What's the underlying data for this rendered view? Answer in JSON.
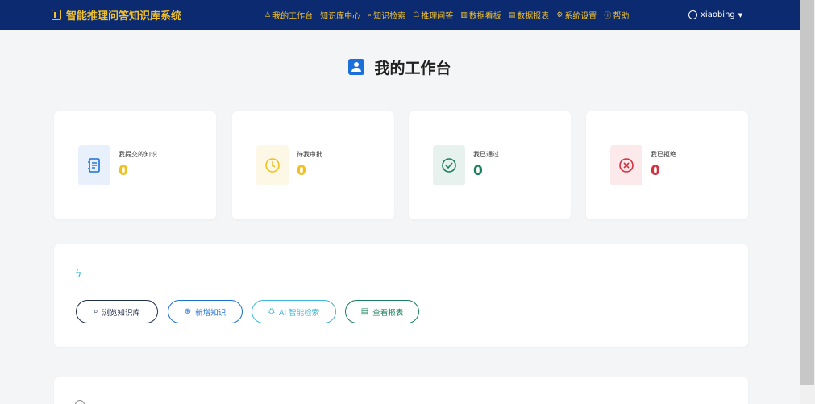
{
  "app": {
    "title": "智能推理问答知识库系统"
  },
  "nav": {
    "items": [
      {
        "icon": "user-icon",
        "glyph": "♙",
        "label": "我的工作台"
      },
      {
        "icon": "",
        "glyph": "",
        "label": "知识库中心"
      },
      {
        "icon": "search-icon",
        "glyph": "⌕",
        "label": "知识检索"
      },
      {
        "icon": "robot-icon",
        "glyph": "☖",
        "label": "推理问答"
      },
      {
        "icon": "chart-icon",
        "glyph": "▥",
        "label": "数据看板"
      },
      {
        "icon": "report-icon",
        "glyph": "▤",
        "label": "数据报表"
      },
      {
        "icon": "gear-icon",
        "glyph": "⚙",
        "label": "系统设置"
      },
      {
        "icon": "help-icon",
        "glyph": "?",
        "label": "帮助"
      }
    ],
    "user": "xiaobing"
  },
  "page": {
    "title": "我的工作台"
  },
  "stats": [
    {
      "label": "我提交的知识",
      "value": "0",
      "icon": "document-icon",
      "color": "#f0c020",
      "bg": "#e8f0fb",
      "icon_color": "#1b6fd8"
    },
    {
      "label": "待我审批",
      "value": "0",
      "icon": "clock-icon",
      "color": "#f0c020",
      "bg": "#fdf8e6",
      "icon_color": "#f0c020"
    },
    {
      "label": "我已通过",
      "value": "0",
      "icon": "check-icon",
      "color": "#1a7f5a",
      "bg": "#e7f2ee",
      "icon_color": "#1a7f5a"
    },
    {
      "label": "我已拒绝",
      "value": "0",
      "icon": "x-circle-icon",
      "color": "#d0333f",
      "bg": "#fbe9eb",
      "icon_color": "#d0333f"
    }
  ],
  "actions": [
    {
      "label": "浏览知识库",
      "icon": "search-icon",
      "glyph": "⌕",
      "color": "#1f2d4a"
    },
    {
      "label": "新增知识",
      "icon": "plus-circle-icon",
      "glyph": "⊕",
      "color": "#1b6fd8"
    },
    {
      "label": "AI 智能检索",
      "icon": "robot-icon",
      "glyph": "⛭",
      "color": "#3fb7d6"
    },
    {
      "label": "查看报表",
      "icon": "report-icon",
      "glyph": "▤",
      "color": "#1a7f5a"
    }
  ]
}
